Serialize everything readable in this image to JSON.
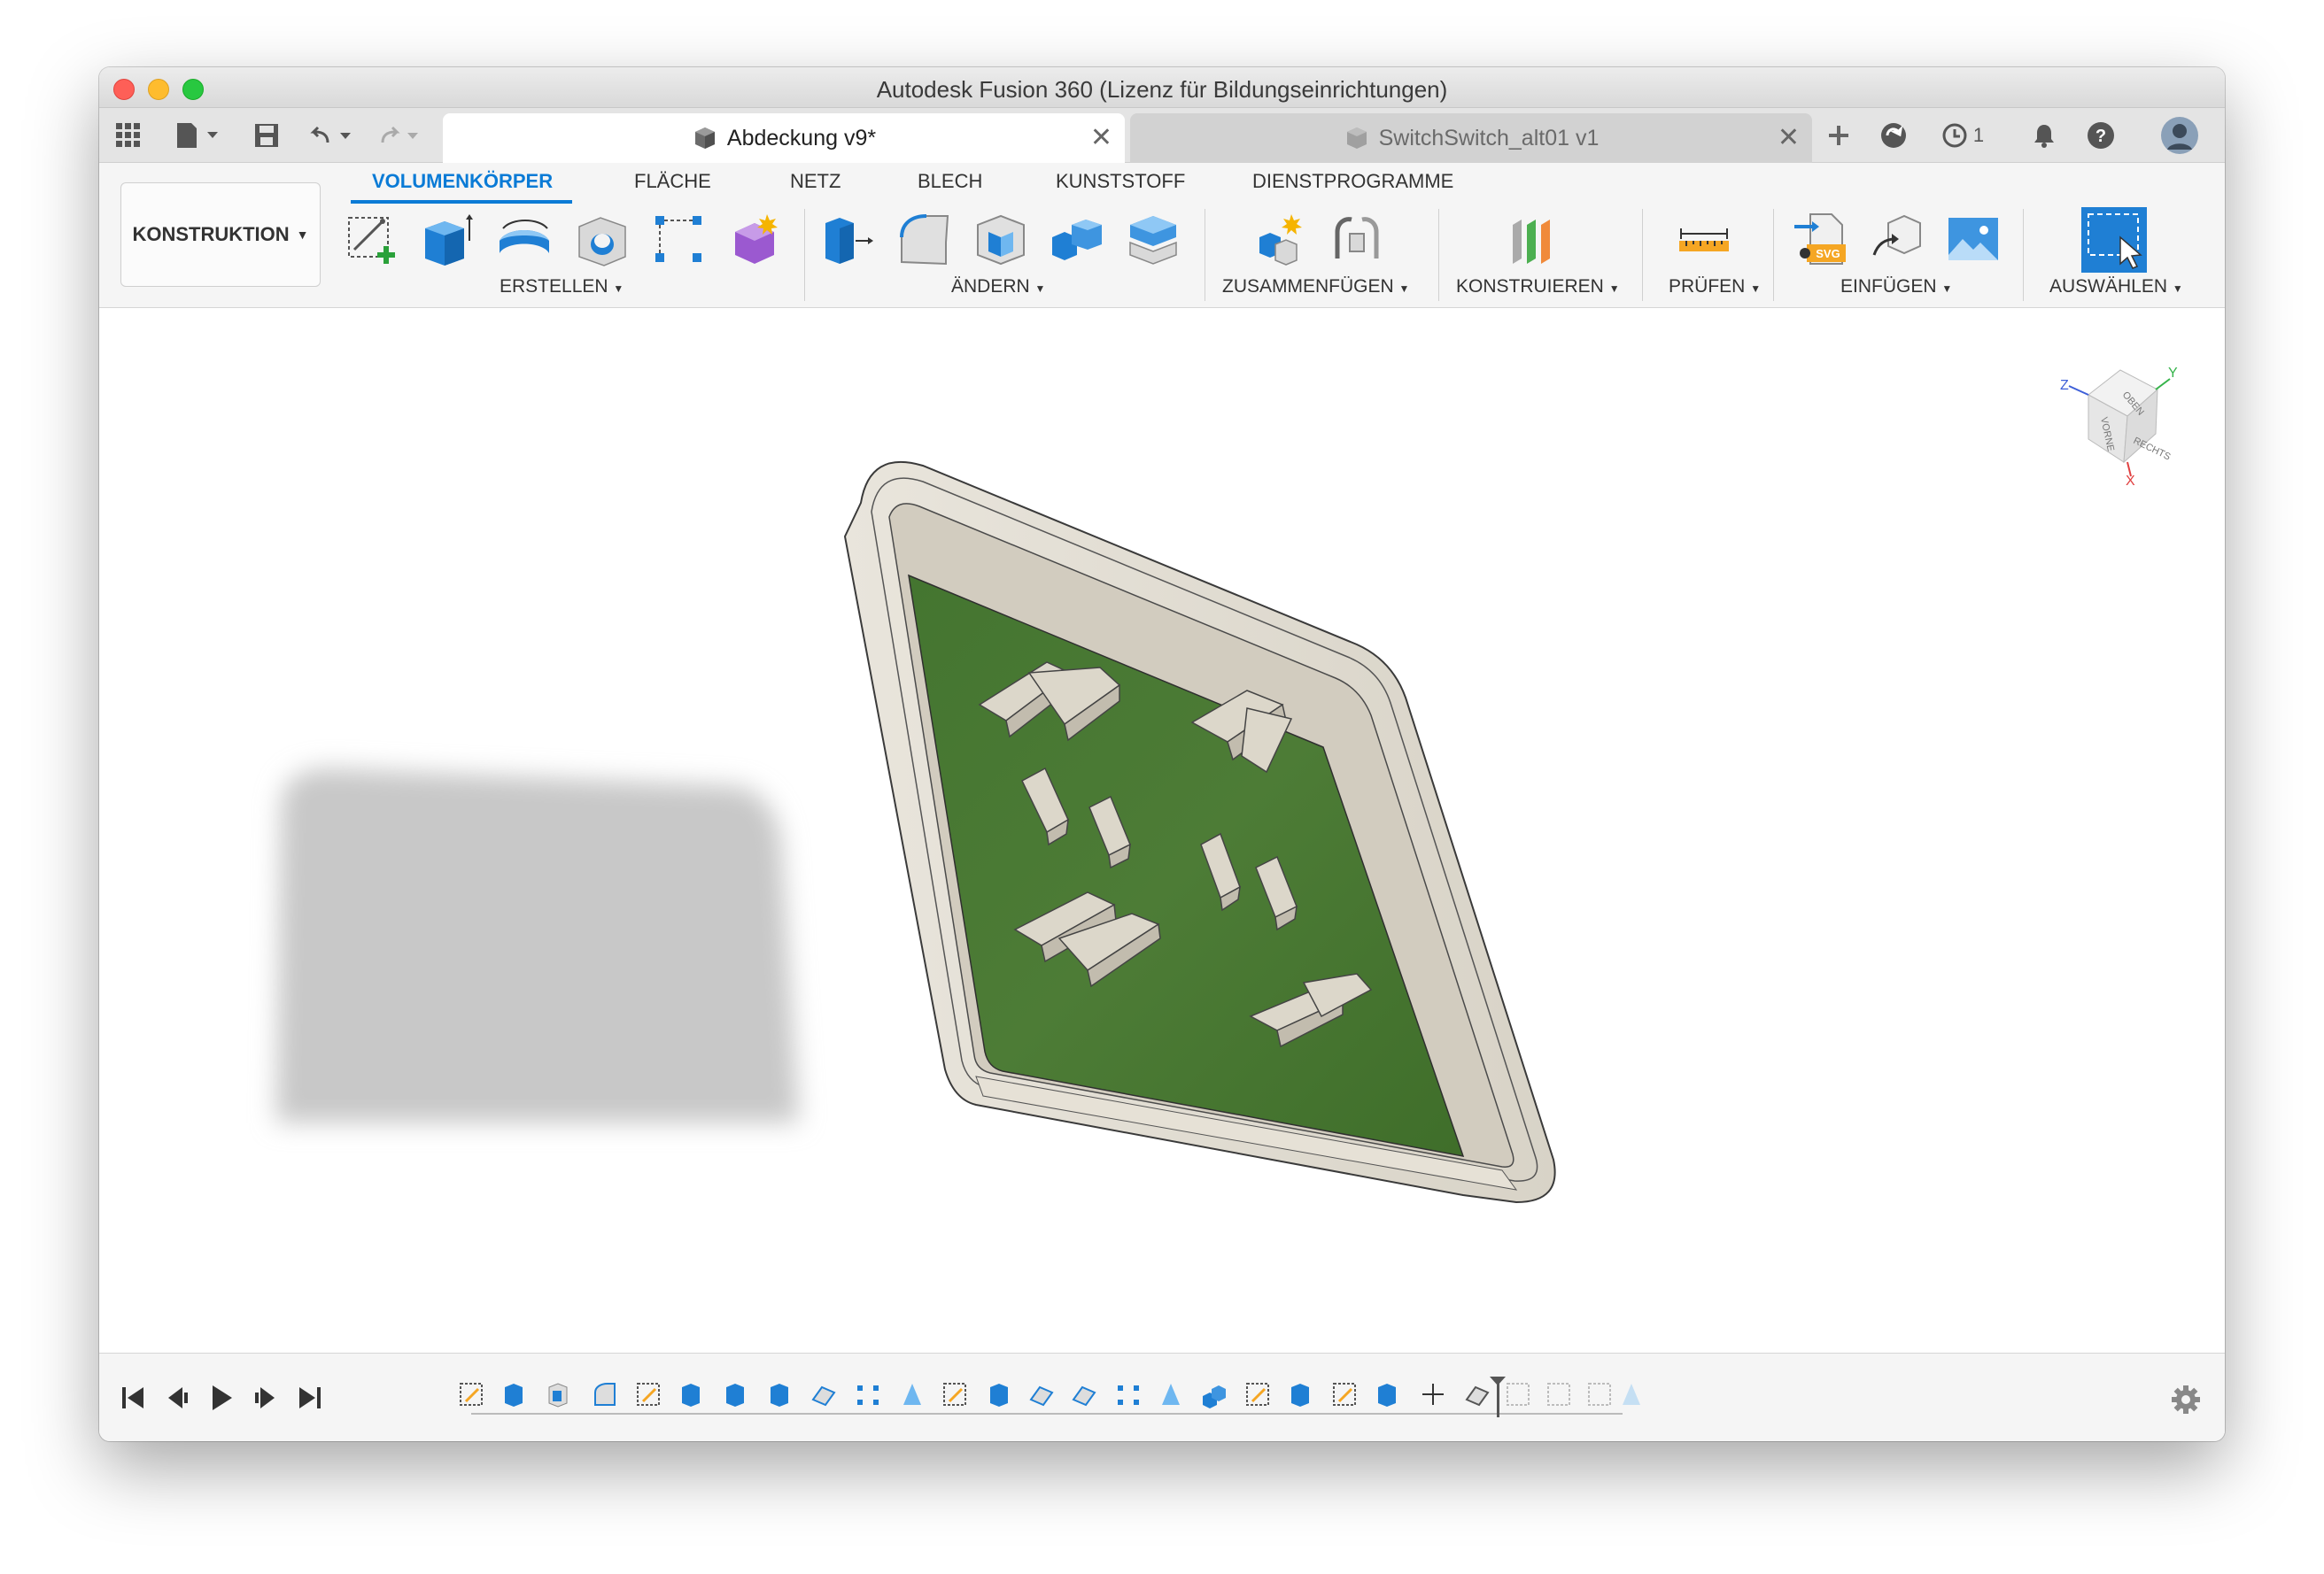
{
  "window": {
    "title": "Autodesk Fusion 360 (Lizenz für Bildungseinrichtungen)"
  },
  "tabs": {
    "active": "Abdeckung v9*",
    "inactive": "SwitchSwitch_alt01 v1",
    "job_count": "1"
  },
  "toolbar": {
    "workspace": "KONSTRUKTION",
    "menu_tabs": [
      "VOLUMENKÖRPER",
      "FLÄCHE",
      "NETZ",
      "BLECH",
      "KUNSTSTOFF",
      "DIENSTPROGRAMME"
    ],
    "groups": {
      "create": "ERSTELLEN",
      "modify": "ÄNDERN",
      "assemble": "ZUSAMMENFÜGEN",
      "construct": "KONSTRUIEREN",
      "inspect": "PRÜFEN",
      "insert": "EINFÜGEN",
      "select": "AUSWÄHLEN"
    }
  },
  "viewcube": {
    "faces": [
      "OBEN",
      "VORNE",
      "RECHTS"
    ],
    "axes": [
      "Z",
      "Y",
      "X"
    ]
  },
  "colors": {
    "accent": "#0a7bd6",
    "pcb_green": "#4a7a32",
    "body_beige": "#e8e4db"
  },
  "timeline": {
    "playback": [
      "first-icon",
      "prev-icon",
      "play-icon",
      "next-icon",
      "last-icon"
    ]
  }
}
